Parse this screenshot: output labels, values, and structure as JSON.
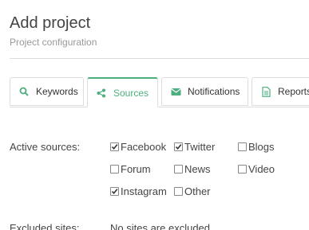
{
  "header": {
    "title": "Add project",
    "subtitle": "Project configuration"
  },
  "tabs": [
    {
      "label": "Keywords",
      "icon": "search-icon",
      "active": false
    },
    {
      "label": "Sources",
      "icon": "share-icon",
      "active": true
    },
    {
      "label": "Notifications",
      "icon": "envelope-icon",
      "active": false
    },
    {
      "label": "Reports",
      "icon": "document-icon",
      "active": false
    }
  ],
  "sources": {
    "label": "Active sources:",
    "options": [
      {
        "label": "Facebook",
        "checked": true
      },
      {
        "label": "Twitter",
        "checked": true
      },
      {
        "label": "Blogs",
        "checked": false
      },
      {
        "label": "Forum",
        "checked": false
      },
      {
        "label": "News",
        "checked": false
      },
      {
        "label": "Video",
        "checked": false
      },
      {
        "label": "Instagram",
        "checked": true
      },
      {
        "label": "Other",
        "checked": false
      }
    ]
  },
  "excluded": {
    "label": "Excluded sites:",
    "value": "No sites are excluded"
  },
  "colors": {
    "accent": "#4caf7d",
    "text": "#444444",
    "muted": "#999999",
    "border": "#dddddd"
  }
}
